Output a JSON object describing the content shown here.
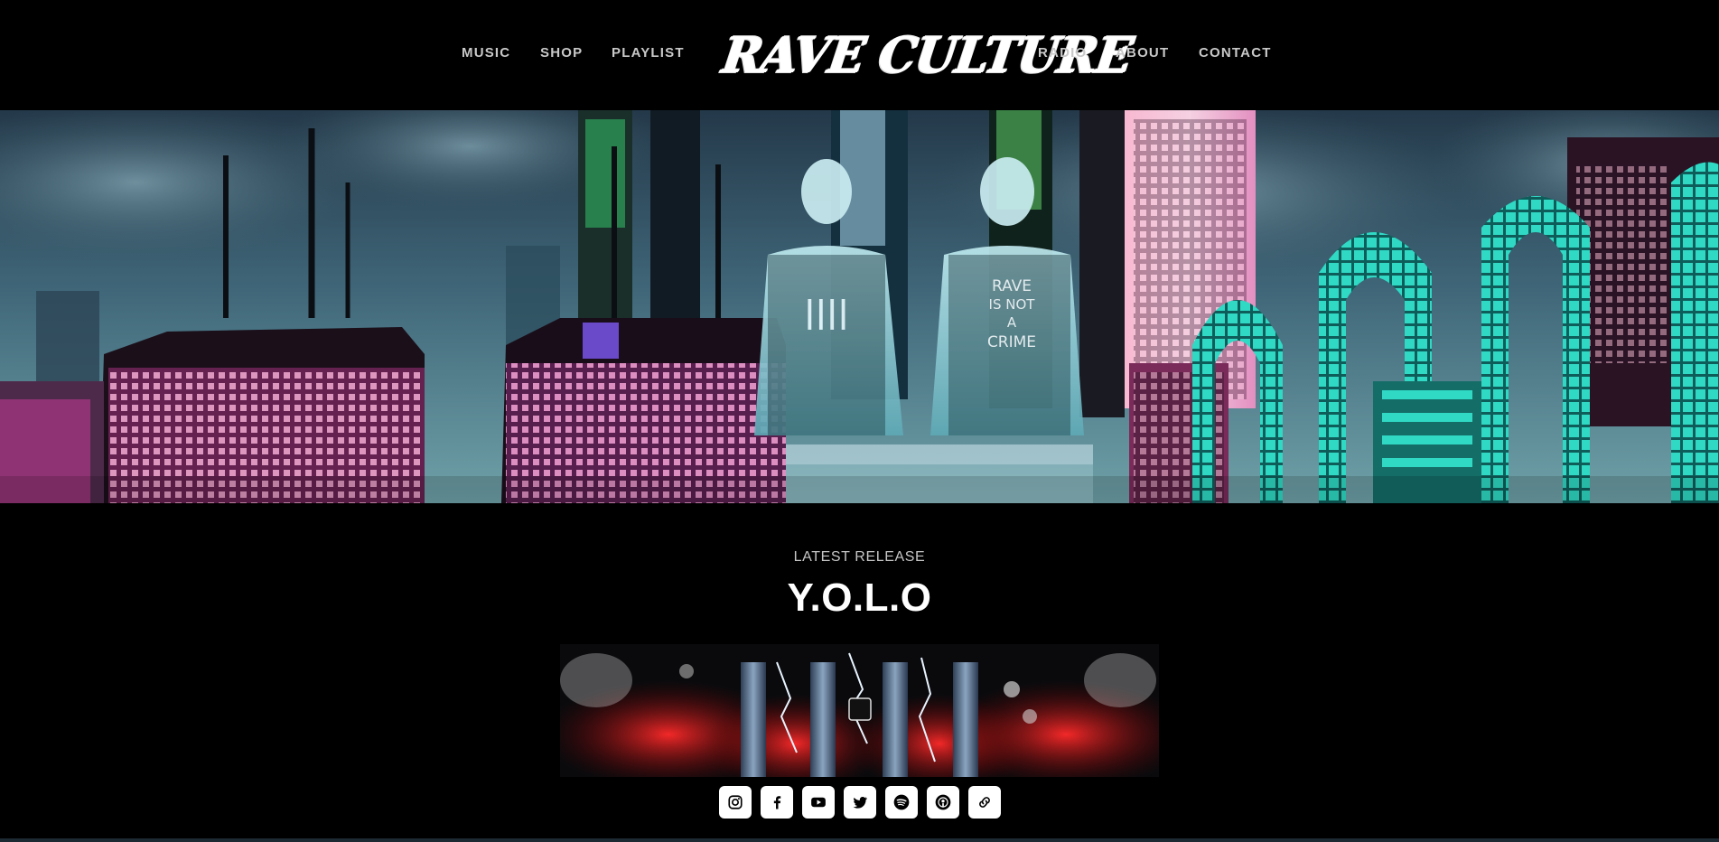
{
  "nav": {
    "left": [
      "MUSIC",
      "SHOP",
      "PLAYLIST"
    ],
    "right": [
      "RADIO",
      "ABOUT",
      "CONTACT"
    ]
  },
  "logo": {
    "text": "RAVE CULTURE"
  },
  "release": {
    "label": "LATEST RELEASE",
    "title": "Y.O.L.O"
  },
  "hero_art": {
    "shirt_left": "||||",
    "shirt_right_lines": [
      "RAVE",
      "IS NOT",
      "A",
      "CRIME"
    ]
  },
  "social": [
    {
      "icon": "instagram-icon"
    },
    {
      "icon": "facebook-icon"
    },
    {
      "icon": "youtube-icon"
    },
    {
      "icon": "twitter-icon"
    },
    {
      "icon": "spotify-icon"
    },
    {
      "icon": "podcast-icon"
    },
    {
      "icon": "link-icon"
    }
  ],
  "colors": {
    "background": "#000000",
    "nav_text": "#c9c9c9",
    "title_text": "#ffffff",
    "accent_pink": "#e23ea8",
    "accent_teal": "#2fd9c4"
  }
}
